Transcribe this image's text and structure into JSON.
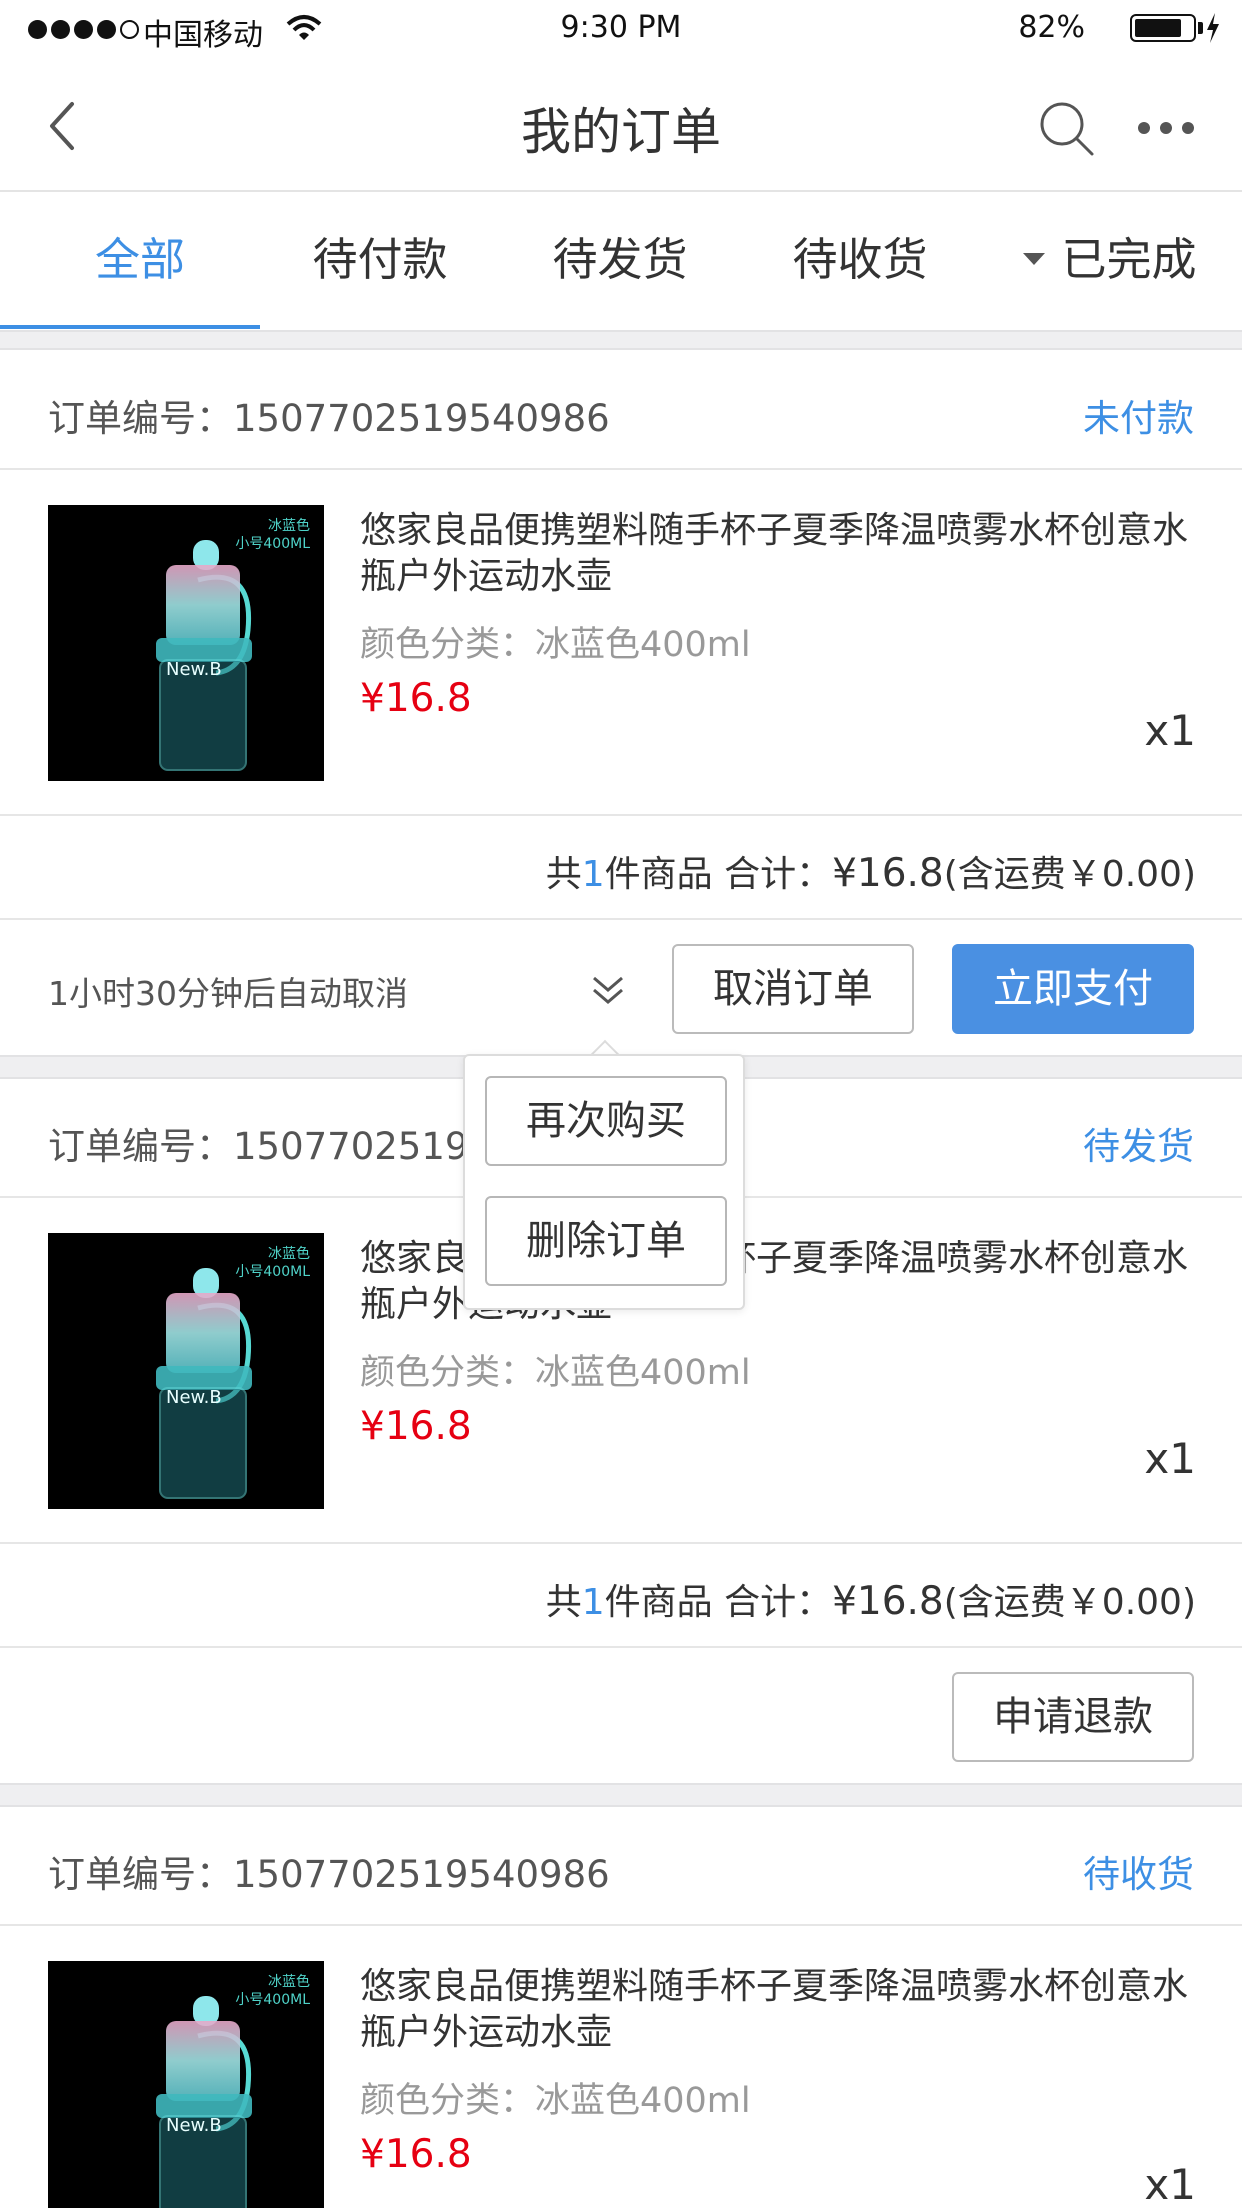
{
  "status_bar": {
    "carrier": "中国移动",
    "time": "9:30 PM",
    "battery": "82%",
    "battery_level": 0.82
  },
  "nav": {
    "title": "我的订单"
  },
  "tabs": [
    {
      "label": "全部",
      "active": true
    },
    {
      "label": "待付款",
      "active": false
    },
    {
      "label": "待发货",
      "active": false
    },
    {
      "label": "待收货",
      "active": false
    },
    {
      "label": "已完成",
      "active": false
    }
  ],
  "orders": [
    {
      "order_no_label": "订单编号：",
      "order_no": "1507702519540986",
      "status": "未付款",
      "thumb_tag_1": "冰蓝色",
      "thumb_tag_2": "小号400ML",
      "thumb_brand": "New.B",
      "title": "悠家良品便携塑料随手杯子夏季降温喷雾水杯创意水瓶户外运动水壶",
      "spec": "颜色分类：冰蓝色400ml",
      "price": "¥16.8",
      "qty": "x1",
      "summary_prefix": "共",
      "summary_count": "1",
      "summary_suffix": "件商品  合计：",
      "summary_amount": "¥16.8",
      "summary_shipping": "(含运费￥0.00)",
      "countdown": "1小时30分钟后自动取消",
      "btn_cancel": "取消订单",
      "btn_pay": "立即支付"
    },
    {
      "order_no_label": "订单编号：",
      "order_no": "1507702519540986",
      "status": "待发货",
      "thumb_tag_1": "冰蓝色",
      "thumb_tag_2": "小号400ML",
      "thumb_brand": "New.B",
      "title": "悠家良品便携塑料随手杯子夏季降温喷雾水杯创意水瓶户外运动水壶",
      "spec": "颜色分类：冰蓝色400ml",
      "price": "¥16.8",
      "qty": "x1",
      "summary_prefix": "共",
      "summary_count": "1",
      "summary_suffix": "件商品  合计：",
      "summary_amount": "¥16.8",
      "summary_shipping": "(含运费￥0.00)",
      "btn_refund": "申请退款"
    },
    {
      "order_no_label": "订单编号：",
      "order_no": "1507702519540986",
      "status": "待收货",
      "thumb_tag_1": "冰蓝色",
      "thumb_tag_2": "小号400ML",
      "thumb_brand": "New.B",
      "title": "悠家良品便携塑料随手杯子夏季降温喷雾水杯创意水瓶户外运动水壶",
      "spec": "颜色分类：冰蓝色400ml",
      "price": "¥16.8",
      "qty": "x1"
    }
  ],
  "popup": {
    "buy_again": "再次购买",
    "delete_order": "删除订单"
  },
  "colors": {
    "accent": "#3d8fe4",
    "primary_button": "#4a90e2",
    "price": "#e60012"
  },
  "icons": [
    "back-icon",
    "search-icon",
    "more-icon",
    "chevron-down-icon",
    "wifi-icon",
    "battery-icon",
    "charging-icon"
  ]
}
